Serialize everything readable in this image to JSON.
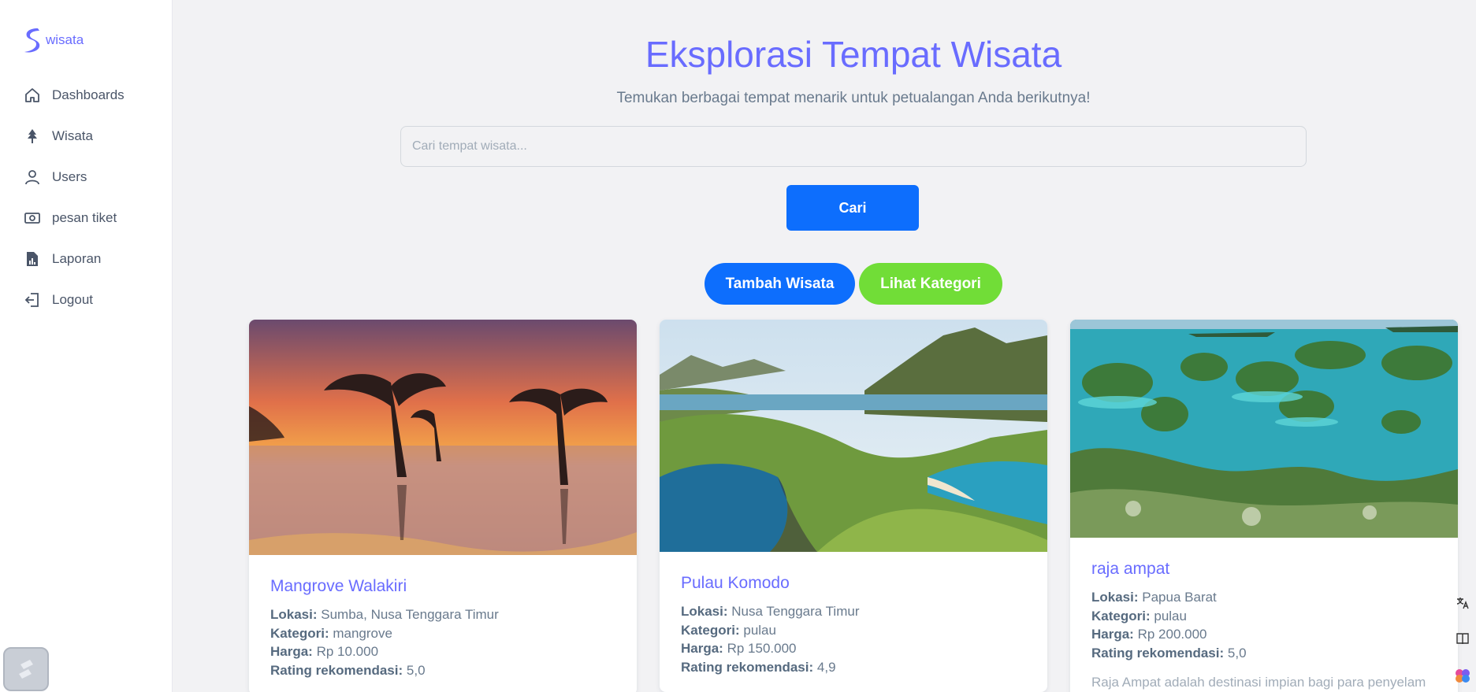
{
  "brand": {
    "name": "wisata",
    "color": "#696cff"
  },
  "sidebar": {
    "items": [
      {
        "label": "Dashboards",
        "icon": "home-icon"
      },
      {
        "label": "Wisata",
        "icon": "tree-icon"
      },
      {
        "label": "Users",
        "icon": "user-icon"
      },
      {
        "label": "pesan tiket",
        "icon": "ticket-icon"
      },
      {
        "label": "Laporan",
        "icon": "report-icon"
      },
      {
        "label": "Logout",
        "icon": "logout-icon"
      }
    ]
  },
  "header": {
    "title": "Eksplorasi Tempat Wisata",
    "subtitle": "Temukan berbagai tempat menarik untuk petualangan Anda berikutnya!"
  },
  "search": {
    "placeholder": "Cari tempat wisata...",
    "value": "",
    "button_label": "Cari"
  },
  "actions": {
    "add_label": "Tambah Wisata",
    "category_label": "Lihat Kategori"
  },
  "labels": {
    "location": "Lokasi:",
    "category": "Kategori:",
    "price": "Harga:",
    "rating": "Rating rekomendasi:"
  },
  "cards": [
    {
      "name": "Mangrove Walakiri",
      "location": "Sumba, Nusa Tenggara Timur",
      "category": "mangrove",
      "price": "Rp 10.000",
      "rating": "5,0"
    },
    {
      "name": "Pulau Komodo",
      "location": "Nusa Tenggara Timur",
      "category": "pulau",
      "price": "Rp 150.000",
      "rating": "4,9"
    },
    {
      "name": "raja ampat",
      "location": "Papua Barat",
      "category": "pulau",
      "price": "Rp 200.000",
      "rating": "5,0",
      "description": "Raja Ampat adalah destinasi impian bagi para penyelam"
    }
  ],
  "colors": {
    "primary": "#0d6efd",
    "success": "#71dd37",
    "accent": "#696cff"
  }
}
